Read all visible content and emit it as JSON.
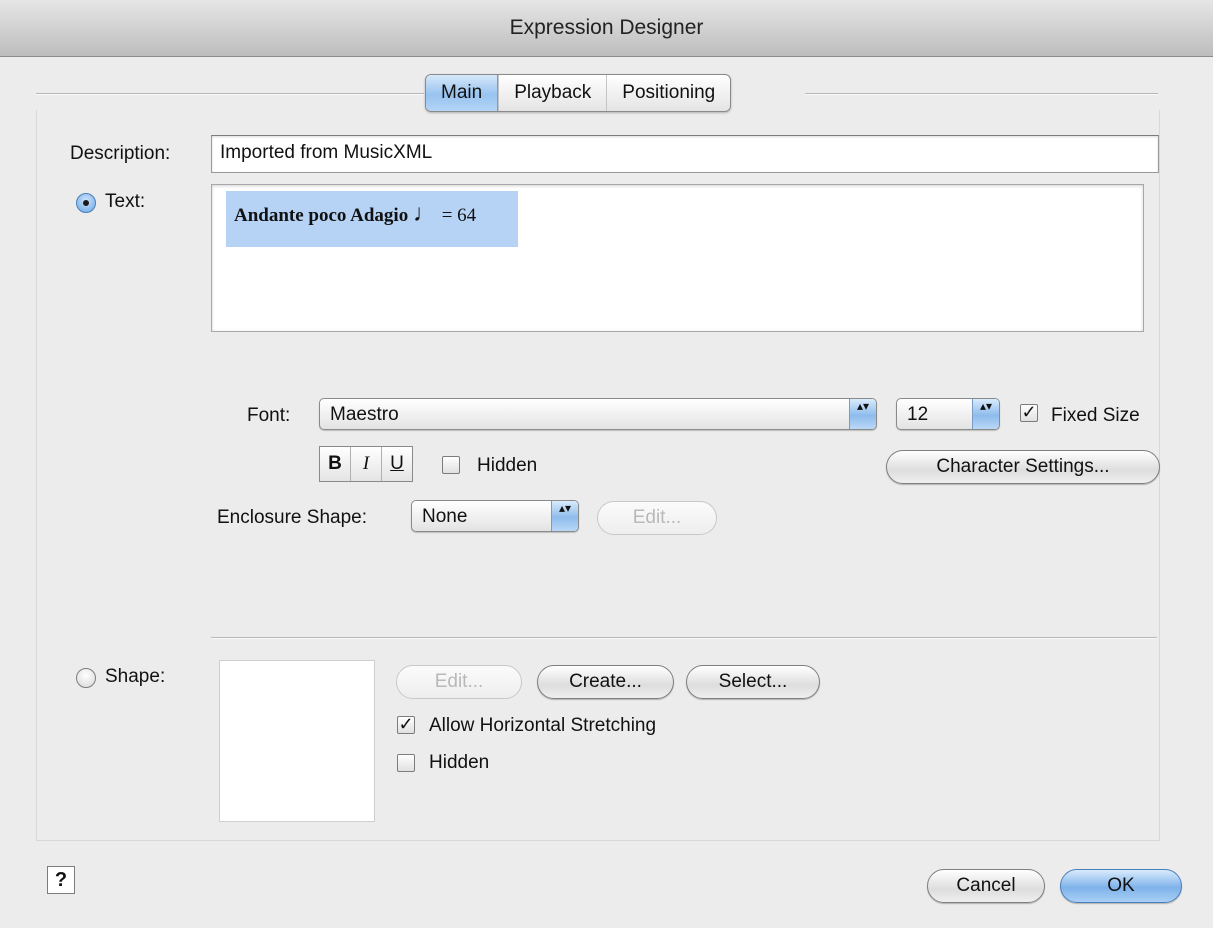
{
  "window": {
    "title": "Expression Designer"
  },
  "tabs": [
    {
      "label": "Main",
      "active": true
    },
    {
      "label": "Playback",
      "active": false
    },
    {
      "label": "Positioning",
      "active": false
    }
  ],
  "description": {
    "label": "Description:",
    "value": "Imported from MusicXML"
  },
  "text_option": {
    "label": "Text:",
    "selected": true,
    "content": "Andante poco Adagio",
    "note_glyph": "♩",
    "tempo": "= 64"
  },
  "font": {
    "label": "Font:",
    "value": "Maestro",
    "size": "12",
    "fixed_size_label": "Fixed Size",
    "fixed_size_checked": true
  },
  "style_buttons": {
    "bold": "B",
    "italic": "I",
    "underline": "U"
  },
  "hidden_text": {
    "label": "Hidden",
    "checked": false
  },
  "character_settings": {
    "label": "Character Settings..."
  },
  "enclosure": {
    "label": "Enclosure Shape:",
    "value": "None",
    "edit_label": "Edit..."
  },
  "shape_option": {
    "label": "Shape:",
    "selected": false
  },
  "shape_buttons": {
    "edit": "Edit...",
    "create": "Create...",
    "select": "Select..."
  },
  "allow_stretch": {
    "label": "Allow Horizontal Stretching",
    "checked": true
  },
  "hidden_shape": {
    "label": "Hidden",
    "checked": false
  },
  "footer": {
    "help": "?",
    "cancel": "Cancel",
    "ok": "OK"
  },
  "icons": {
    "check": "✓",
    "popup_arrows": "▴▾"
  },
  "colors": {
    "accent": "#8ebcec",
    "selection": "#b6d3f6"
  }
}
